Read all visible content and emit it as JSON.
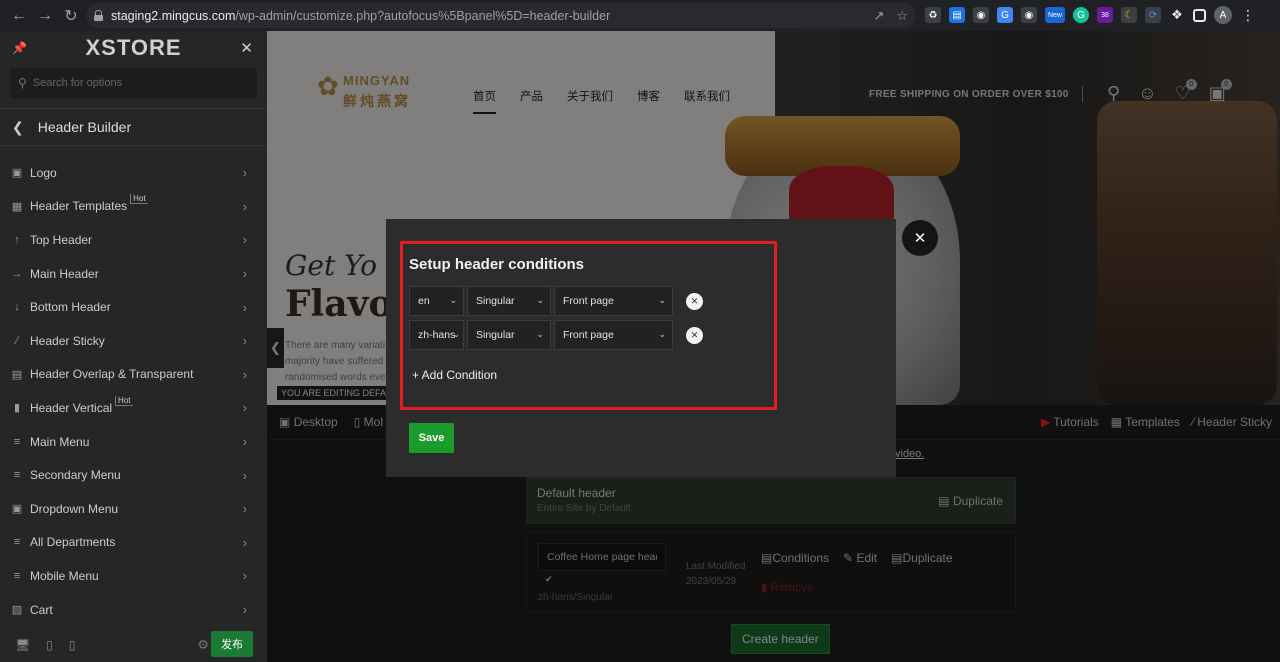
{
  "browser": {
    "url_host": "staging2.mingcus.com",
    "url_path": "/wp-admin/customize.php?autofocus%5Bpanel%5D=header-builder",
    "ext_badge_new": "New",
    "ext_badge_count": "38",
    "avatar_letter": "A"
  },
  "sidebar": {
    "logo": "XSTORE",
    "search_placeholder": "Search for options",
    "section_title": "Header Builder",
    "hot_label": "Hot",
    "items": [
      {
        "label": "Logo",
        "icon": "image-icon"
      },
      {
        "label": "Header Templates",
        "icon": "grid-icon",
        "hot": true
      },
      {
        "label": "Top Header",
        "icon": "arrow-up-icon"
      },
      {
        "label": "Main Header",
        "icon": "arrow-right-icon"
      },
      {
        "label": "Bottom Header",
        "icon": "arrow-down-icon"
      },
      {
        "label": "Header Sticky",
        "icon": "pin-icon"
      },
      {
        "label": "Header Overlap & Transparent",
        "icon": "layers-icon"
      },
      {
        "label": "Header Vertical",
        "icon": "vertical-icon",
        "hot": true
      },
      {
        "label": "Main Menu",
        "icon": "menu-icon"
      },
      {
        "label": "Secondary Menu",
        "icon": "menu-icon"
      },
      {
        "label": "Dropdown Menu",
        "icon": "dropdown-icon"
      },
      {
        "label": "All Departments",
        "icon": "menu-icon"
      },
      {
        "label": "Mobile Menu",
        "icon": "menu-icon"
      },
      {
        "label": "Cart",
        "icon": "cart-icon"
      }
    ],
    "publish_label": "发布"
  },
  "preview": {
    "brand_name": "MINGYAN",
    "brand_sub": "鲜炖燕窝",
    "nav": [
      "首页",
      "产品",
      "关于我们",
      "博客",
      "联系我们"
    ],
    "shipping": "FREE SHIPPING ON ORDER OVER $100",
    "hero_script": "Get Yo",
    "hero_title": "Flavor",
    "hero_para": "There are many variati majority have suffered randomised words eve",
    "editing_label": "YOU ARE EDITING DEFA"
  },
  "builder": {
    "device_desktop": "Desktop",
    "device_mobile": "Mol",
    "tutorials": "Tutorials",
    "templates": "Templates",
    "header_sticky": "Header Sticky",
    "video_link": "video.",
    "default_header_title": "Default header",
    "default_header_sub": "Entire Site by Default",
    "duplicate": "Duplicate",
    "item_name": "Coffee Home page header",
    "item_conditions": "zh-hans/Singular",
    "last_modified_label": "Last Modified",
    "last_modified_date": "2023/05/29",
    "conditions": "Conditions",
    "edit": "Edit",
    "remove": "Remove",
    "create_header": "Create header"
  },
  "modal": {
    "title": "Setup header conditions",
    "rows": [
      {
        "lang": "en",
        "type": "Singular",
        "page": "Front page"
      },
      {
        "lang": "zh-hans",
        "type": "Singular",
        "page": "Front page"
      }
    ],
    "add_condition": "+ Add Condition",
    "save": "Save"
  },
  "colors": {
    "accent_green": "#1a9b2b",
    "highlight_red": "#e01e24",
    "brand_gold": "#b48a4a"
  }
}
